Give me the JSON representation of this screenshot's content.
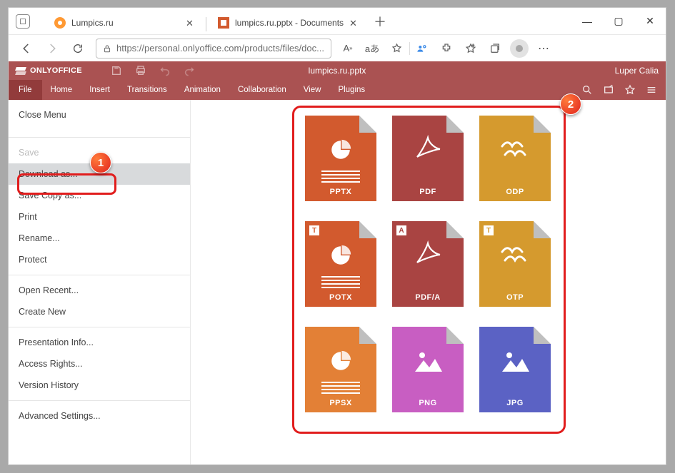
{
  "browser": {
    "tabs": [
      {
        "title": "Lumpics.ru"
      },
      {
        "title": "lumpics.ru.pptx - Documents"
      }
    ],
    "url": "https://personal.onlyoffice.com/products/files/doc...",
    "addr_icons": {
      "translate": "Aあ",
      "readaloud": "аあ"
    }
  },
  "onlyoffice": {
    "brand": "ONLYOFFICE",
    "doc_title": "lumpics.ru.pptx",
    "user": "Luper Calia",
    "tabs": [
      "File",
      "Home",
      "Insert",
      "Transitions",
      "Animation",
      "Collaboration",
      "View",
      "Plugins"
    ]
  },
  "filemenu": {
    "close": "Close Menu",
    "groups": [
      [
        {
          "label": "Save",
          "disabled": true
        },
        {
          "label": "Download as...",
          "selected": true
        },
        {
          "label": "Save Copy as..."
        },
        {
          "label": "Print"
        },
        {
          "label": "Rename..."
        },
        {
          "label": "Protect"
        }
      ],
      [
        {
          "label": "Open Recent..."
        },
        {
          "label": "Create New"
        }
      ],
      [
        {
          "label": "Presentation Info..."
        },
        {
          "label": "Access Rights..."
        },
        {
          "label": "Version History"
        }
      ],
      [
        {
          "label": "Advanced Settings..."
        }
      ]
    ]
  },
  "formats": [
    {
      "label": "PPTX",
      "color": "#d25a2e",
      "icon": "pie"
    },
    {
      "label": "PDF",
      "color": "#a94442",
      "icon": "pdf"
    },
    {
      "label": "ODP",
      "color": "#d59a2e",
      "icon": "birds"
    },
    {
      "label": "POTX",
      "color": "#d25a2e",
      "icon": "pie",
      "t": true
    },
    {
      "label": "PDF/A",
      "color": "#a94442",
      "icon": "pdf",
      "a": true
    },
    {
      "label": "OTP",
      "color": "#d59a2e",
      "icon": "birds",
      "t": true
    },
    {
      "label": "PPSX",
      "color": "#e38036",
      "icon": "pie"
    },
    {
      "label": "PNG",
      "color": "#c85ec2",
      "icon": "img"
    },
    {
      "label": "JPG",
      "color": "#5b62c4",
      "icon": "img"
    }
  ],
  "callouts": {
    "one": "1",
    "two": "2"
  }
}
